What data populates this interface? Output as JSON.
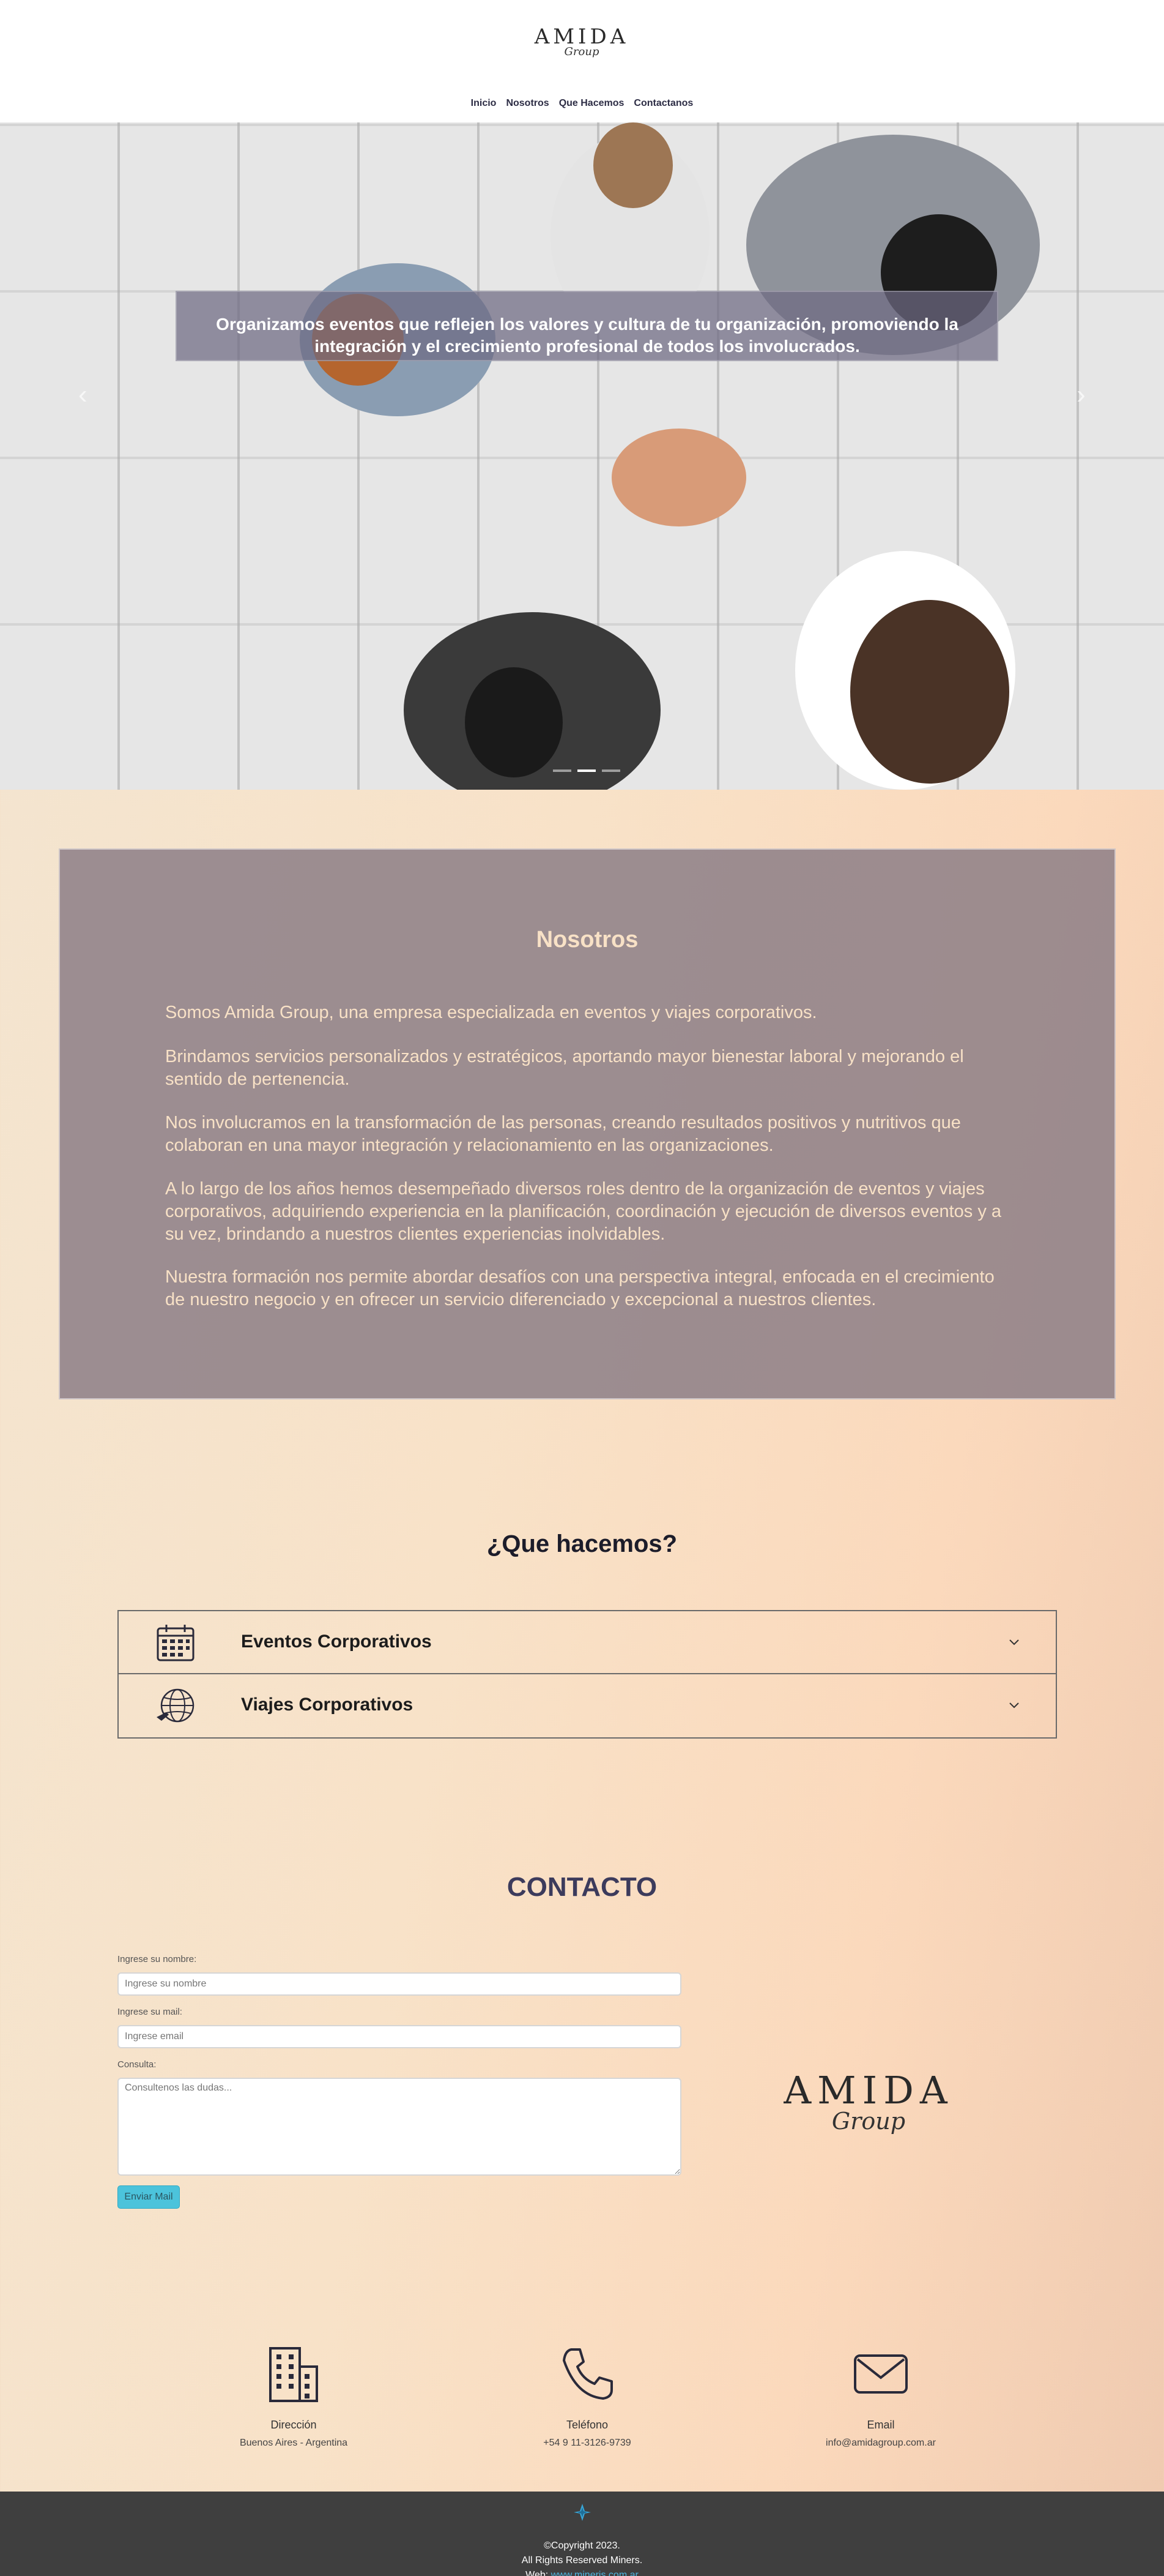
{
  "header": {
    "logo_word": "AMIDA",
    "logo_script": "Group",
    "nav": [
      "Inicio",
      "Nosotros",
      "Que Hacemos",
      "Contactanos"
    ]
  },
  "hero": {
    "caption": "Organizamos eventos que reflejen los valores y cultura de tu organización, promoviendo la integración y el crecimiento profesional de todos los involucrados.",
    "prev_arrow": "‹",
    "next_arrow": "›",
    "slides": 3,
    "active_slide": 2
  },
  "nosotros": {
    "title": "Nosotros",
    "paragraphs": [
      "Somos Amida Group, una empresa especializada en eventos y viajes corporativos.",
      "Brindamos servicios personalizados y estratégicos, aportando mayor bienestar laboral y mejorando el sentido de pertenencia.",
      "Nos involucramos en la transformación de las personas, creando resultados positivos y nutritivos que colaboran en una mayor integración y relacionamiento en las organizaciones.",
      "A lo largo de los años hemos desempeñado diversos roles dentro de la organización de eventos y viajes corporativos, adquiriendo experiencia en la planificación, coordinación y ejecución de diversos eventos y a su vez, brindando a nuestros clientes experiencias inolvidables.",
      "Nuestra formación nos permite abordar desafíos con una perspectiva integral, enfocada en el crecimiento de nuestro negocio y en ofrecer un servicio diferenciado y excepcional a nuestros clientes."
    ]
  },
  "que_hacemos": {
    "title": "¿Que hacemos?",
    "items": [
      {
        "label": "Eventos Corporativos",
        "icon": "calendar-icon"
      },
      {
        "label": "Viajes Corporativos",
        "icon": "globe-plane-icon"
      }
    ]
  },
  "contacto": {
    "title": "CONTACTO",
    "name_label": "Ingrese su nombre:",
    "name_placeholder": "Ingrese su nombre",
    "mail_label": "Ingrese su mail:",
    "mail_placeholder": "Ingrese email",
    "query_label": "Consulta:",
    "query_placeholder": "Consultenos las dudas...",
    "send_label": "Enviar Mail",
    "logo_word": "AMIDA",
    "logo_script": "Group"
  },
  "info": [
    {
      "title": "Dirección",
      "value": "Buenos Aires - Argentina",
      "icon": "building-icon"
    },
    {
      "title": "Teléfono",
      "value": "+54 9 11-3126-9739",
      "icon": "phone-icon"
    },
    {
      "title": "Email",
      "value": "info@amidagroup.com.ar",
      "icon": "envelope-icon"
    }
  ],
  "footer": {
    "copyright": "©Copyright 2023.",
    "rights": "All Rights Reserved Miners.",
    "web_label": "Web:",
    "web_link": "www.mineris.com.ar"
  },
  "colors": {
    "accent_cyan": "#4cc3db",
    "nosotros_text": "#f8e1c6",
    "contact_title": "#3c3b5c",
    "footer_bg": "#3f3f3f"
  }
}
